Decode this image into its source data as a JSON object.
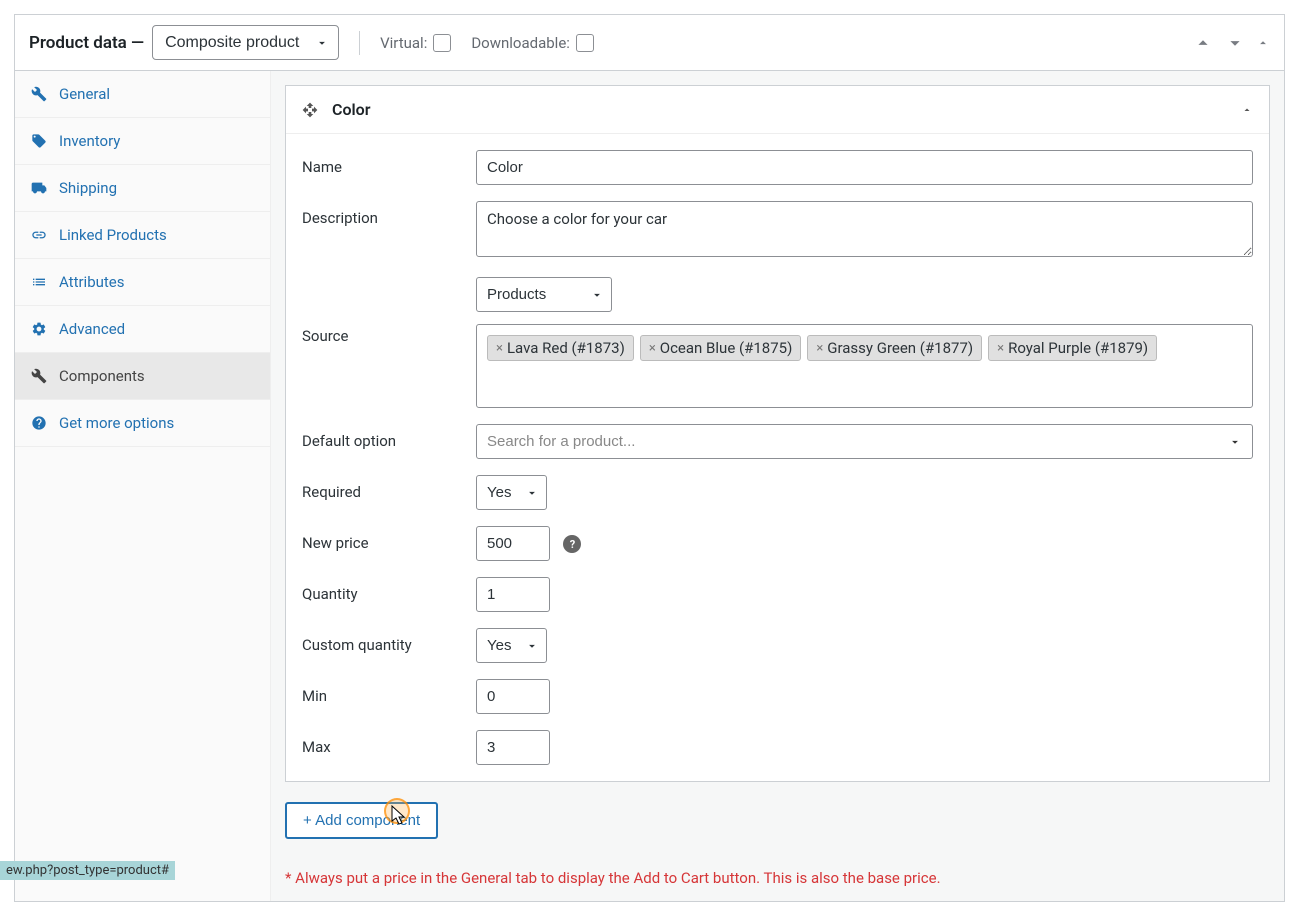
{
  "header": {
    "title": "Product data —",
    "product_type": "Composite product",
    "virtual_label": "Virtual:",
    "downloadable_label": "Downloadable:"
  },
  "sidebar": {
    "items": [
      {
        "label": "General"
      },
      {
        "label": "Inventory"
      },
      {
        "label": "Shipping"
      },
      {
        "label": "Linked Products"
      },
      {
        "label": "Attributes"
      },
      {
        "label": "Advanced"
      },
      {
        "label": "Components"
      },
      {
        "label": "Get more options"
      }
    ]
  },
  "component": {
    "title": "Color",
    "fields": {
      "name": {
        "label": "Name",
        "value": "Color"
      },
      "description": {
        "label": "Description",
        "value": "Choose a color for your car"
      },
      "source": {
        "label": "Source",
        "type": "Products",
        "tags": [
          "Lava Red (#1873)",
          "Ocean Blue (#1875)",
          "Grassy Green (#1877)",
          "Royal Purple (#1879)"
        ]
      },
      "default_option": {
        "label": "Default option",
        "placeholder": "Search for a product..."
      },
      "required": {
        "label": "Required",
        "value": "Yes"
      },
      "new_price": {
        "label": "New price",
        "value": "500"
      },
      "quantity": {
        "label": "Quantity",
        "value": "1"
      },
      "custom_quantity": {
        "label": "Custom quantity",
        "value": "Yes"
      },
      "min": {
        "label": "Min",
        "value": "0"
      },
      "max": {
        "label": "Max",
        "value": "3"
      }
    }
  },
  "buttons": {
    "add_component": "+ Add component"
  },
  "note": "* Always put a price in the General tab to display the Add to Cart button. This is also the base price.",
  "status_bar": "ew.php?post_type=product#"
}
